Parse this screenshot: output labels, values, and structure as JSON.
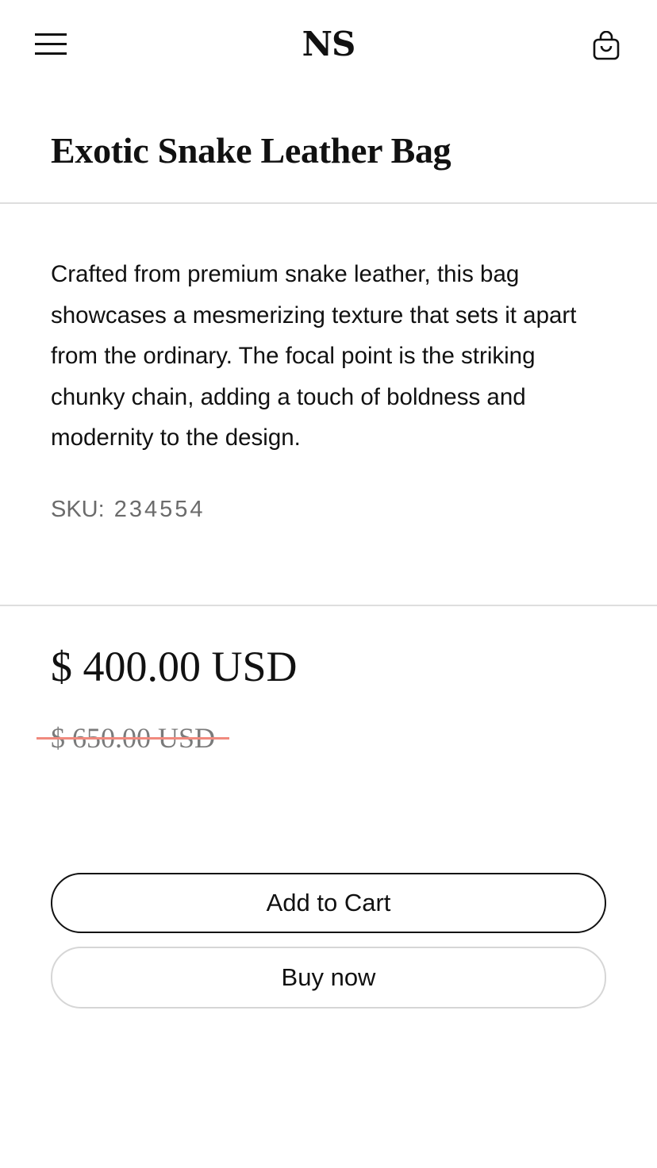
{
  "header": {
    "logo": "NS",
    "menu_icon": "hamburger-menu-icon",
    "cart_icon": "shopping-bag-icon"
  },
  "product": {
    "title": "Exotic Snake Leather Bag",
    "description": "Crafted from premium snake leather, this bag showcases a mesmerizing texture that sets it apart from the ordinary. The focal point is the striking chunky chain, adding a touch of boldness and modernity to the design.",
    "sku_label": "SKU:",
    "sku_value": "234554"
  },
  "pricing": {
    "current": "$ 400.00 USD",
    "compare_at": "$ 650.00 USD",
    "strike_color": "#f08a7e"
  },
  "actions": {
    "add_to_cart": "Add to Cart",
    "buy_now": "Buy now"
  }
}
